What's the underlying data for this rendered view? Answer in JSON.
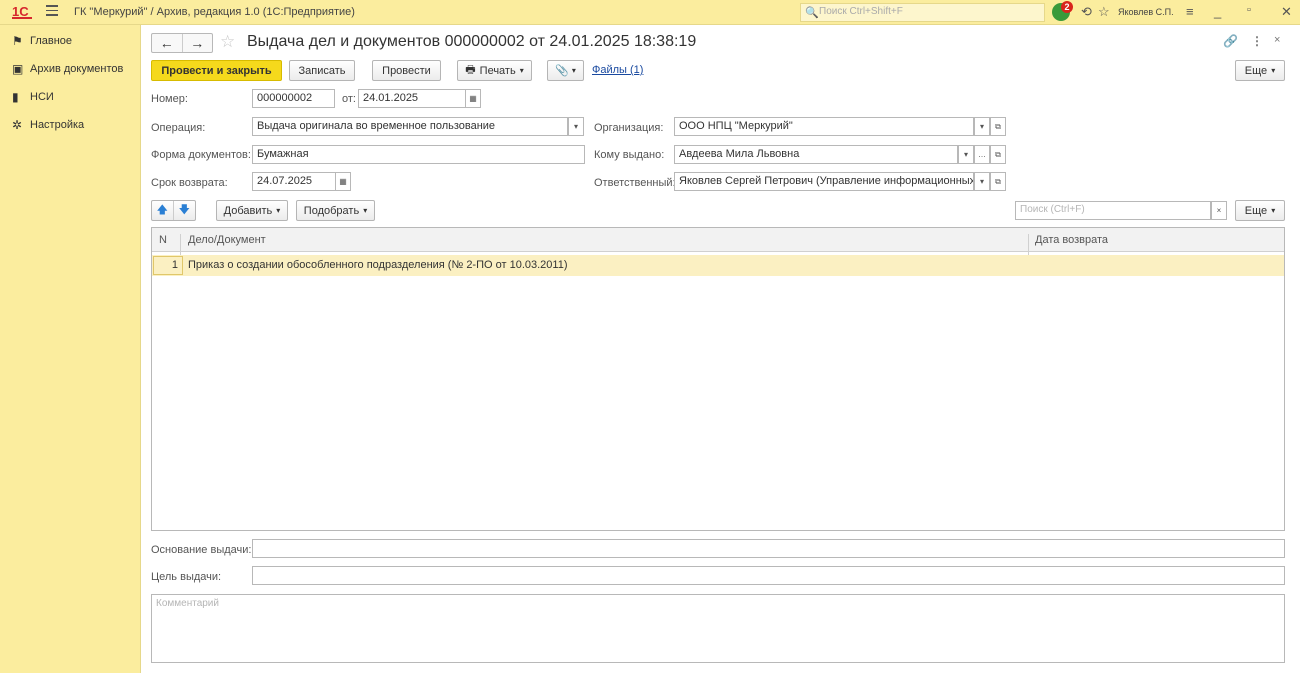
{
  "topbar": {
    "logo": "1С",
    "app_title": "ГК \"Меркурий\" / Архив, редакция 1.0  (1С:Предприятие)",
    "search_placeholder": "Поиск Ctrl+Shift+F",
    "notifications_count": "2",
    "user": "Яковлев С.П."
  },
  "sidebar": {
    "items": [
      {
        "label": "Главное",
        "icon": "flag-icon"
      },
      {
        "label": "Архив документов",
        "icon": "archive-box-icon"
      },
      {
        "label": "НСИ",
        "icon": "book-icon"
      },
      {
        "label": "Настройка",
        "icon": "gear-icon"
      }
    ]
  },
  "document": {
    "title": "Выдача дел и документов 000000002 от 24.01.2025 18:38:19"
  },
  "toolbar": {
    "post_close": "Провести и закрыть",
    "save": "Записать",
    "post": "Провести",
    "print": "Печать",
    "files": "Файлы (1)",
    "more": "Еще"
  },
  "form": {
    "number_label": "Номер:",
    "number": "000000002",
    "from_label": "от:",
    "date": "24.01.2025",
    "operation_label": "Операция:",
    "operation": "Выдача оригинала во временное пользование",
    "organization_label": "Организация:",
    "organization": "ООО НПЦ \"Меркурий\"",
    "doc_form_label": "Форма документов:",
    "doc_form": "Бумажная",
    "issued_to_label": "Кому выдано:",
    "issued_to": "Авдеева Мила Львовна",
    "return_label": "Срок возврата:",
    "return_date": "24.07.2025",
    "responsible_label": "Ответственный:",
    "responsible": "Яковлев Сергей Петрович (Управление информационных те:"
  },
  "table_toolbar": {
    "add": "Добавить",
    "pick": "Подобрать",
    "search_placeholder": "Поиск (Ctrl+F)",
    "clear": "×",
    "more": "Еще"
  },
  "table": {
    "columns": [
      "N",
      "Дело/Документ",
      "Дата возврата"
    ],
    "rows": [
      {
        "n": "1",
        "doc": "Приказ о создании обособленного подразделения (№ 2-ПО от 10.03.2011)",
        "return_date": ""
      }
    ]
  },
  "bottom": {
    "basis_label": "Основание выдачи:",
    "basis": "",
    "purpose_label": "Цель выдачи:",
    "purpose": "",
    "comment_placeholder": "Комментарий"
  }
}
